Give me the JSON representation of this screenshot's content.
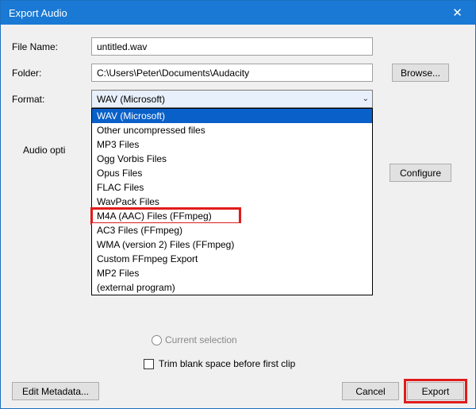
{
  "window": {
    "title": "Export Audio"
  },
  "labels": {
    "file_name": "File Name:",
    "folder": "Folder:",
    "format": "Format:",
    "audio_options": "Audio opti",
    "current_selection": "Current selection",
    "trim_blank": "Trim blank space before first clip"
  },
  "fields": {
    "file_name_value": "untitled.wav",
    "folder_value": "C:\\Users\\Peter\\Documents\\Audacity",
    "format_selected": "WAV (Microsoft)"
  },
  "buttons": {
    "browse": "Browse...",
    "configure": "Configure",
    "edit_metadata": "Edit Metadata...",
    "cancel": "Cancel",
    "export": "Export"
  },
  "format_options": [
    "WAV (Microsoft)",
    "Other uncompressed files",
    "MP3 Files",
    "Ogg Vorbis Files",
    "Opus Files",
    "FLAC Files",
    "WavPack Files",
    "M4A (AAC) Files (FFmpeg)",
    "AC3 Files (FFmpeg)",
    "WMA (version 2) Files (FFmpeg)",
    "Custom FFmpeg Export",
    "MP2 Files",
    "(external program)"
  ],
  "highlights": {
    "dropdown_item_index": 7,
    "export_button": true
  },
  "colors": {
    "titlebar_bg": "#1979d4",
    "selection_bg": "#0a60c9",
    "highlight_border": "#e01b1b"
  }
}
